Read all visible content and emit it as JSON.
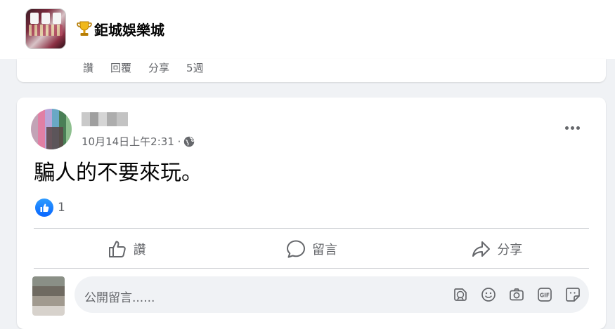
{
  "page": {
    "name": "鉅城娛樂城",
    "trophy_emoji": "🏆"
  },
  "previous_post": {
    "actions": [
      "讚",
      "回覆",
      "分享",
      "5週"
    ]
  },
  "post": {
    "timestamp": "10月14日上午2:31 ·",
    "privacy_icon": "globe-icon",
    "text": "騙人的不要來玩。",
    "reaction_count": "1",
    "actions": {
      "like": "讚",
      "comment": "留言",
      "share": "分享"
    }
  },
  "comment_input": {
    "placeholder": "公開留言......"
  },
  "colors": {
    "accent": "#0866ff",
    "secondary_text": "#65676b",
    "background": "#f0f2f5"
  }
}
